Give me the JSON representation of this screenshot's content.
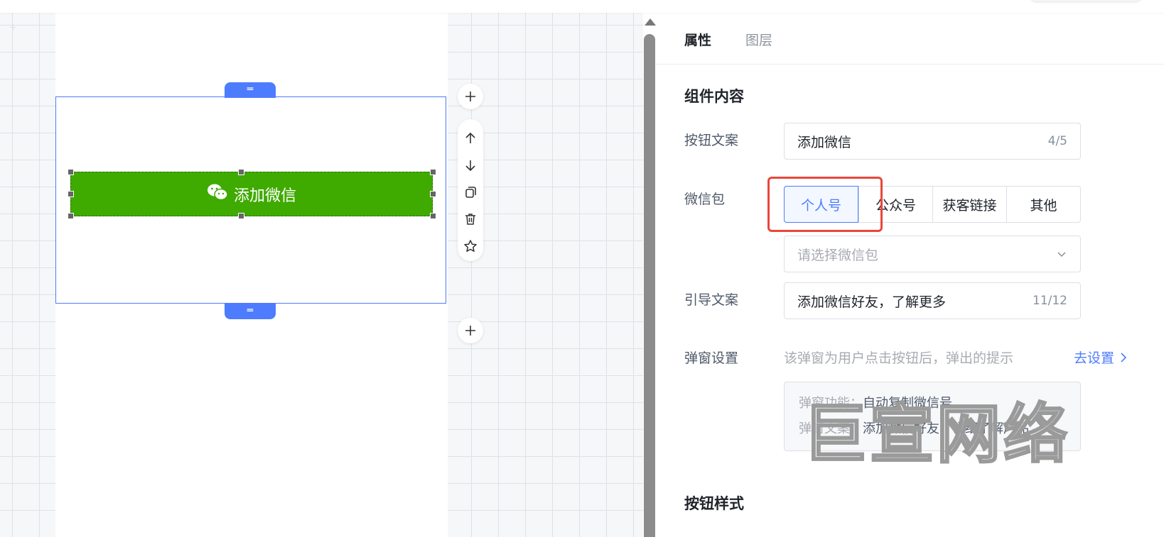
{
  "panel": {
    "tabs": [
      {
        "label": "属性",
        "active": true
      },
      {
        "label": "图层",
        "active": false
      }
    ],
    "section_component_content": "组件内容",
    "button_text": {
      "label": "按钮文案",
      "value": "添加微信",
      "count": "4/5"
    },
    "wechat_pack": {
      "label": "微信包",
      "options": [
        "个人号",
        "公众号",
        "获客链接",
        "其他"
      ],
      "selected": "个人号",
      "select_placeholder": "请选择微信包"
    },
    "guide_text": {
      "label": "引导文案",
      "value": "添加微信好友，了解更多",
      "count": "11/12"
    },
    "popup_settings": {
      "label": "弹窗设置",
      "description": "该弹窗为用户点击按钮后，弹出的提示",
      "link": "去设置",
      "function_key": "弹窗功能：",
      "function_value": "自动复制微信号",
      "text_key": "弹窗文案：",
      "text_value": "添加微信好友，详细了解产品"
    },
    "section_button_style": "按钮样式"
  },
  "canvas": {
    "button_label": "添加微信",
    "button_color": "#3faa00",
    "selection_color": "#4d7cfe",
    "drag_handle_icon": "═",
    "tools": [
      "plus-icon",
      "arrow-up-icon",
      "arrow-down-icon",
      "copy-icon",
      "trash-icon",
      "star-icon"
    ]
  },
  "watermark": "巨宣网络",
  "colors": {
    "accent": "#4d7cfe",
    "highlight": "#e8473b"
  }
}
